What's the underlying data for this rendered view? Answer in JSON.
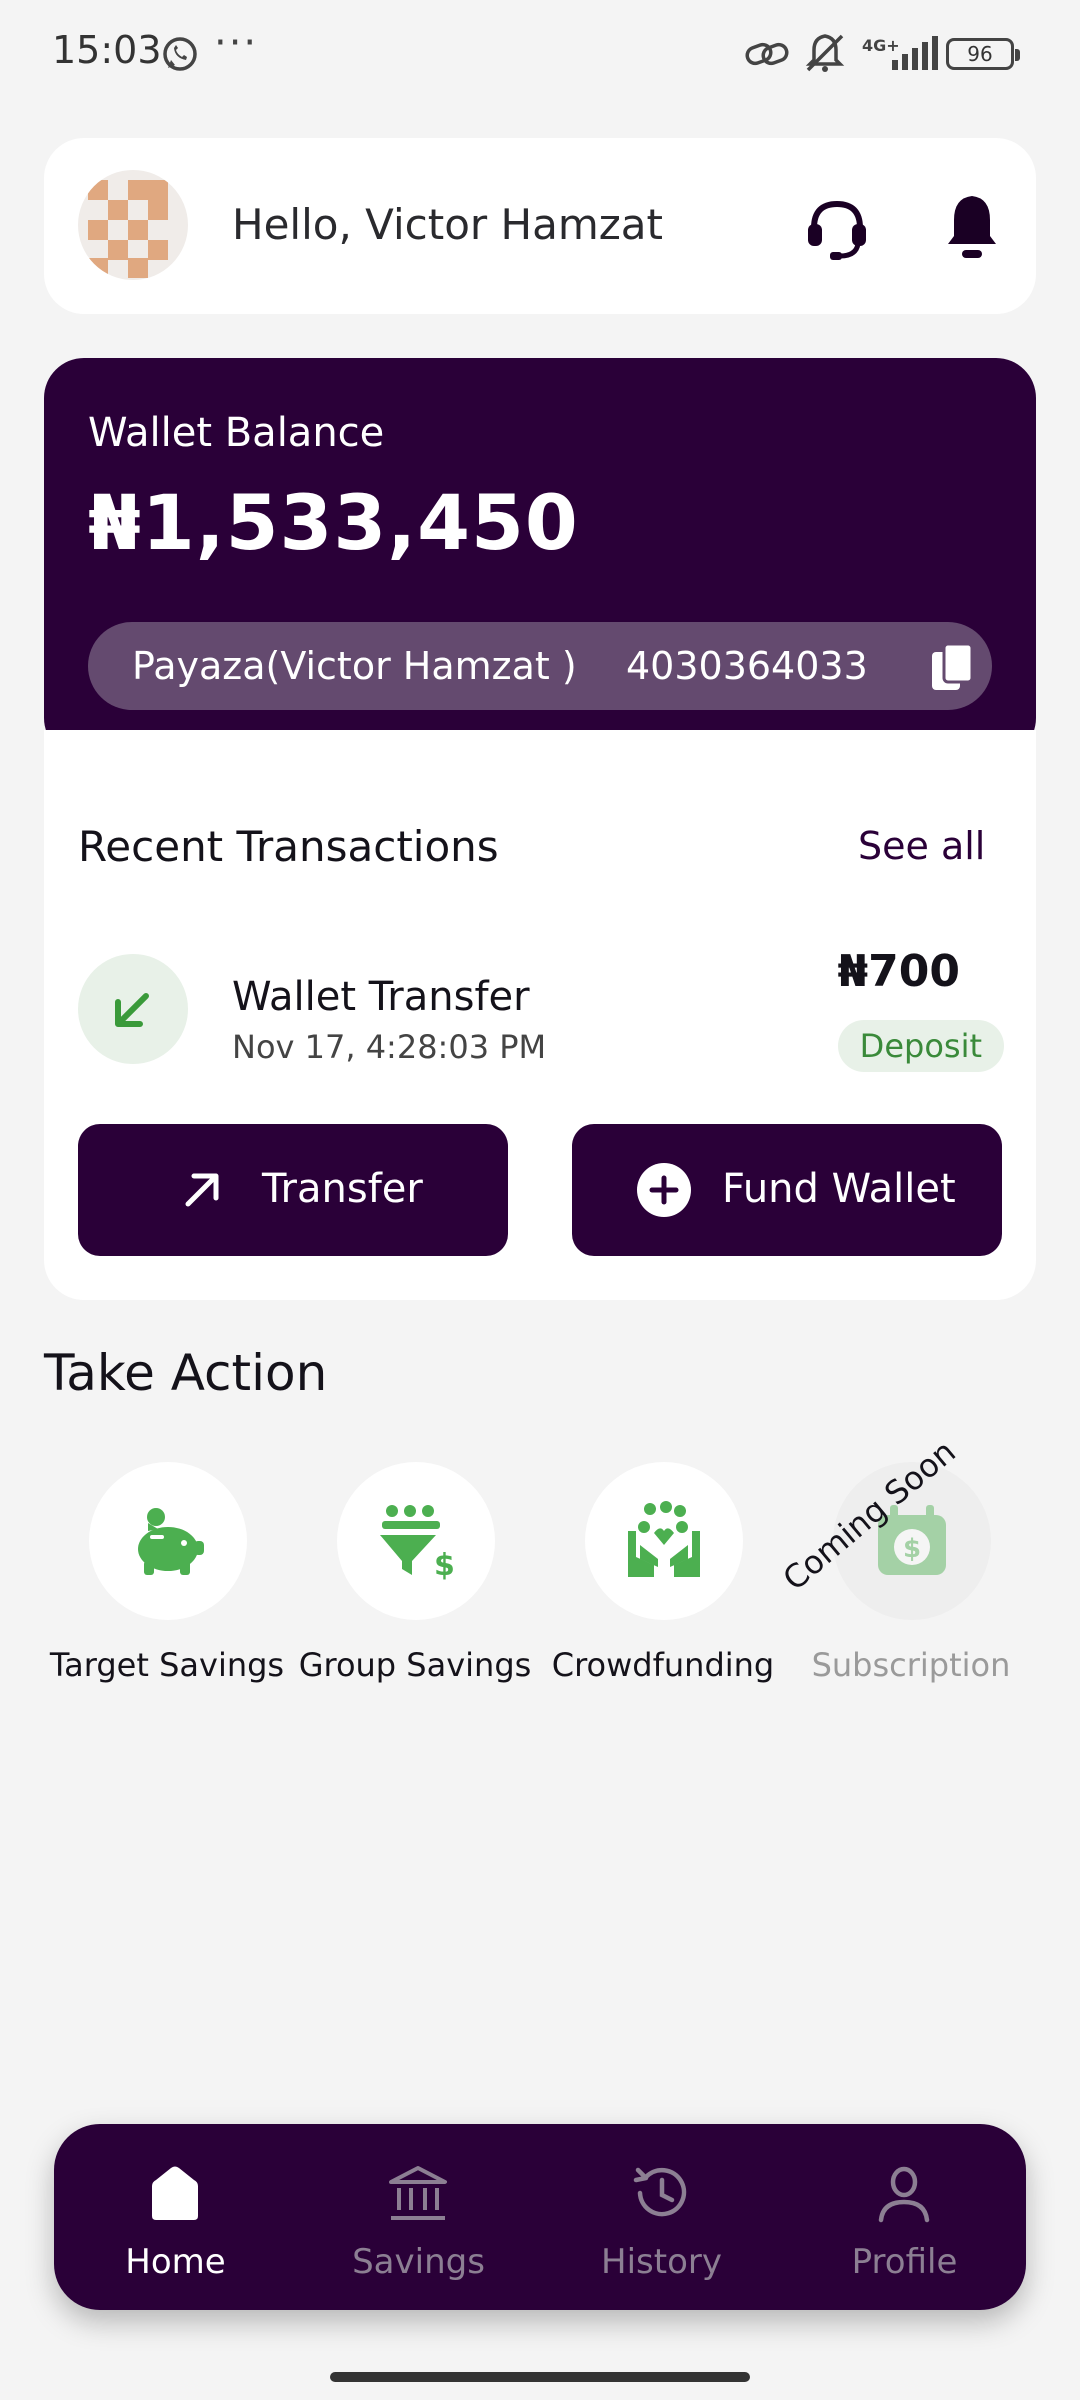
{
  "status_bar": {
    "time": "15:03",
    "dots": "···",
    "network": "4G+",
    "battery": "96"
  },
  "header": {
    "greeting": "Hello, Victor  Hamzat",
    "icons": [
      "avatar",
      "support-headset-icon",
      "bell-icon"
    ]
  },
  "wallet": {
    "label": "Wallet Balance",
    "balance": "₦1,533,450",
    "account_name": "Payaza(Victor  Hamzat )",
    "account_number": "4030364033",
    "colors": {
      "card": "#2a0038",
      "pill": "#644a6f"
    }
  },
  "transactions": {
    "title": "Recent Transactions",
    "see_all": "See all",
    "items": [
      {
        "name": "Wallet Transfer",
        "date": "Nov 17, 4:28:03 PM",
        "amount": "₦700",
        "type": "Deposit",
        "icon": "arrow-down-left-icon"
      }
    ]
  },
  "buttons": {
    "transfer": "Transfer",
    "fund_wallet": "Fund Wallet"
  },
  "take_action": {
    "title": "Take Action",
    "items": [
      {
        "label": "Target Savings",
        "icon": "piggy-bank-icon"
      },
      {
        "label": "Group Savings",
        "icon": "group-savings-icon"
      },
      {
        "label": "Crowdfunding",
        "icon": "crowdfunding-icon"
      },
      {
        "label": "Subscription",
        "icon": "subscription-icon",
        "disabled": true
      }
    ],
    "coming_soon": "Coming Soon"
  },
  "nav": {
    "items": [
      {
        "label": "Home",
        "icon": "home-icon",
        "active": true
      },
      {
        "label": "Savings",
        "icon": "bank-icon"
      },
      {
        "label": "History",
        "icon": "history-icon"
      },
      {
        "label": "Profile",
        "icon": "profile-icon"
      }
    ]
  },
  "colors": {
    "primary": "#2a0038",
    "accent_green": "#4caf50",
    "background": "#f4f4f4"
  }
}
